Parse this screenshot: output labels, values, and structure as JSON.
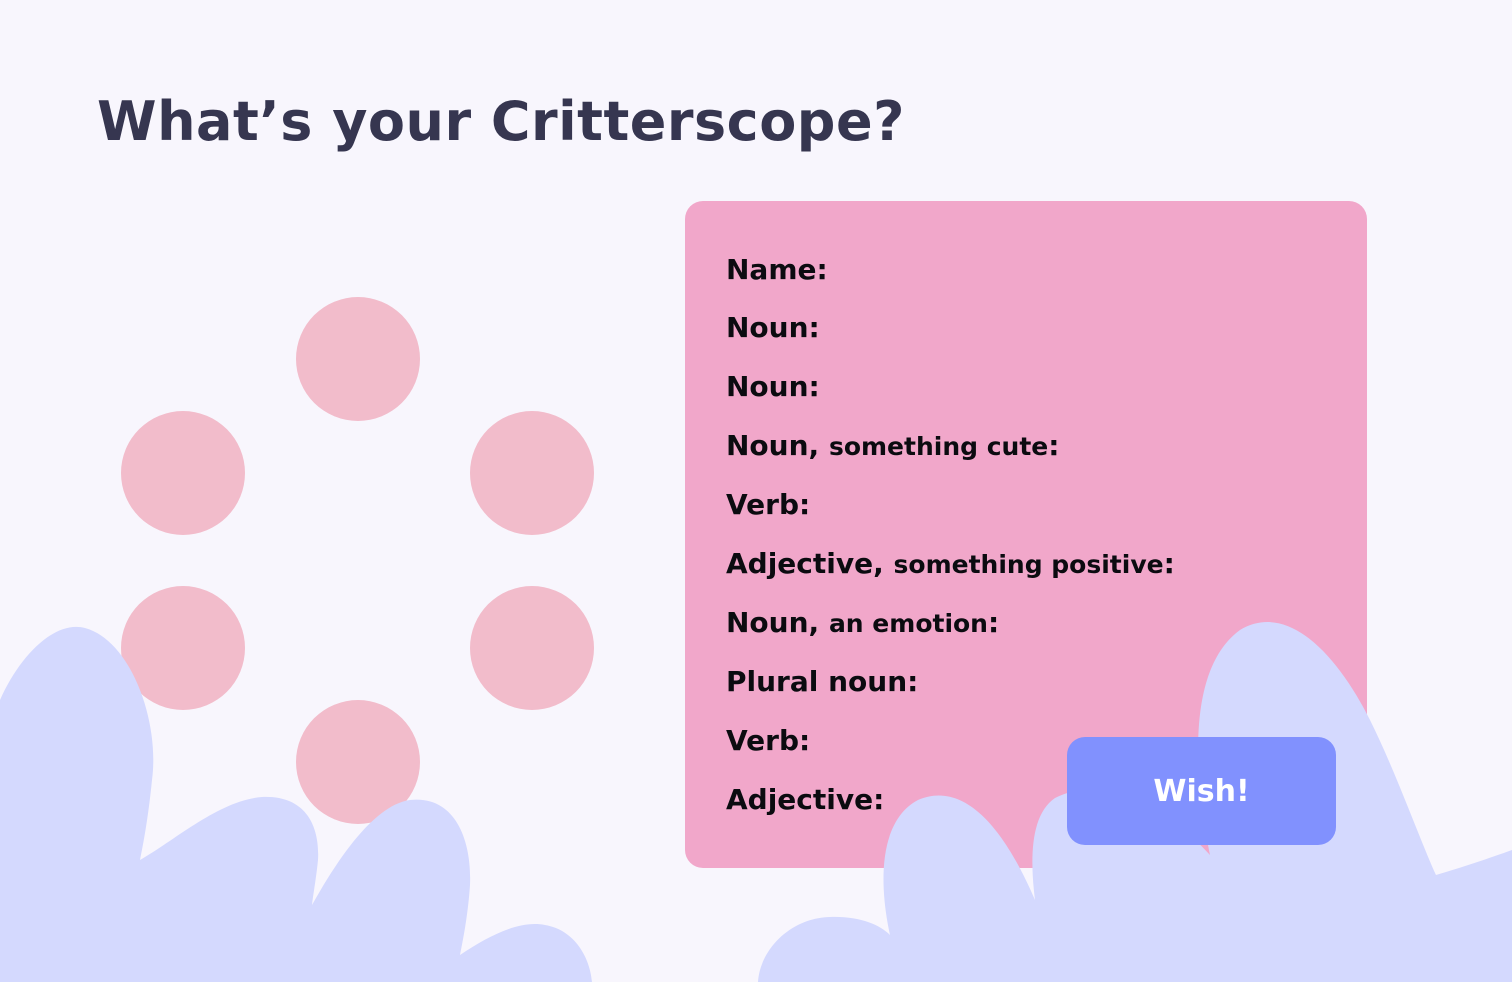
{
  "page": {
    "title": "What’s your Critterscope?"
  },
  "colors": {
    "background": "#f8f6fd",
    "title": "#363650",
    "card": "#f1a7ca",
    "dot": "#f2bccb",
    "blob": "#d4d9fe",
    "button": "#8191fe",
    "button_text": "#ffffff",
    "label_text": "#0b0b10"
  },
  "form": {
    "fields": [
      {
        "label": "Name",
        "hint": ""
      },
      {
        "label": "Noun",
        "hint": ""
      },
      {
        "label": "Noun",
        "hint": ""
      },
      {
        "label": "Noun,",
        "hint": "something cute"
      },
      {
        "label": "Verb",
        "hint": ""
      },
      {
        "label": "Adjective,",
        "hint": "something positive"
      },
      {
        "label": "Noun,",
        "hint": "an emotion"
      },
      {
        "label": "Plural noun",
        "hint": ""
      },
      {
        "label": "Verb",
        "hint": ""
      },
      {
        "label": "Adjective",
        "hint": ""
      }
    ],
    "submit_label": "Wish!"
  }
}
